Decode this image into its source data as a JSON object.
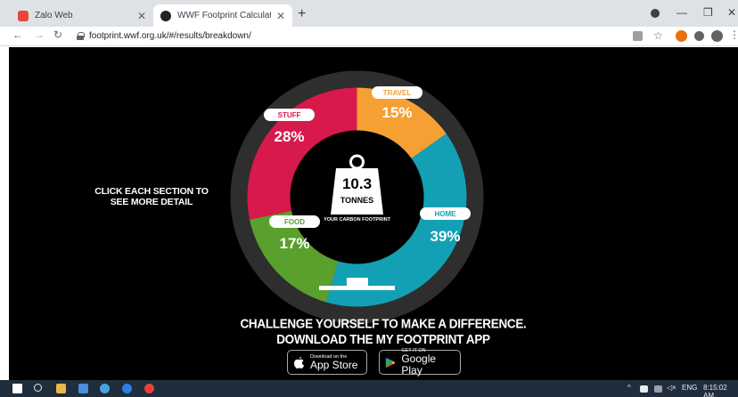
{
  "browser": {
    "tabs": [
      {
        "title": "Zalo Web",
        "active": false
      },
      {
        "title": "WWF Footprint Calculator",
        "active": true
      }
    ],
    "new_tab": "+",
    "close_glyph": "✕",
    "window_controls": {
      "minimize": "—",
      "restore": "❐",
      "close": "✕"
    },
    "nav": {
      "back": "←",
      "forward": "→",
      "reload": "↻"
    },
    "url": "footprint.wwf.org.uk/#/results/breakdown/",
    "star": "☆"
  },
  "page": {
    "side_instruction": "CLICK EACH SECTION TO SEE MORE DETAIL",
    "center": {
      "value": "10.3",
      "unit": "TONNES",
      "caption": "YOUR CARBON FOOTPRINT"
    },
    "segments": [
      {
        "label": "TRAVEL",
        "percent": "15%",
        "value": 15,
        "color": "#f5a032"
      },
      {
        "label": "HOME",
        "percent": "39%",
        "value": 39,
        "color": "#14a0b4"
      },
      {
        "label": "FOOD",
        "percent": "17%",
        "value": 17,
        "color": "#5aa02d"
      },
      {
        "label": "STUFF",
        "percent": "28%",
        "value": 28,
        "color": "#d7194b"
      }
    ],
    "cta_line1": "CHALLENGE YOURSELF TO MAKE A DIFFERENCE.",
    "cta_line2": "DOWNLOAD THE MY FOOTPRINT APP",
    "app_store": {
      "small": "Download on the",
      "big": "App Store"
    },
    "google_play": {
      "small": "GET IT ON",
      "big": "Google Play"
    }
  },
  "taskbar": {
    "language": "ENG",
    "time": "8:15:02 AM"
  }
}
